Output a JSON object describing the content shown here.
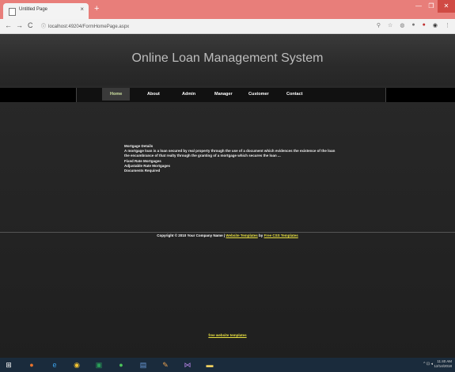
{
  "browser": {
    "tab_title": "Untitled Page",
    "tab_close": "×",
    "new_tab": "+",
    "url_prefix": "ⓘ",
    "url": "localhost:49204/FormHomePage.aspx",
    "back": "←",
    "forward": "→",
    "reload": "C",
    "window_buttons": {
      "minimize": "—",
      "maximize": "❐",
      "close": "✕"
    },
    "toolbar_icons": [
      "search-icon",
      "star-icon",
      "extension-icon",
      "extension-icon",
      "opera-icon",
      "account-icon",
      "menu-icon"
    ]
  },
  "site": {
    "title": "Online Loan Management System",
    "menu": [
      {
        "label": "Home",
        "active": true
      },
      {
        "label": "About",
        "active": false
      },
      {
        "label": "Admin",
        "active": false
      },
      {
        "label": "Manager",
        "active": false
      },
      {
        "label": "Customer",
        "active": false
      },
      {
        "label": "Contact",
        "active": false
      }
    ],
    "content": {
      "heading": "Mortgage Details",
      "line1": "A mortgage loan is a loan secured by real property through the use of a document which evidences the existence of the loan",
      "line2": "the encumbrance of that realty through the granting of a mortgage which secures the loan ...",
      "items": [
        "Fixed Rate Mortgages",
        "Adjustable Rate Mortgages",
        "Documents Required"
      ]
    },
    "footer": {
      "prefix": "Copyright © 2010 Your Company Name |",
      "link1": "Website Templates",
      "mid": "by",
      "link2": "Free CSS Templates"
    },
    "bottom_link": "free website templates"
  },
  "taskbar": {
    "icons": [
      "windows-icon",
      "firefox-icon",
      "ie-icon",
      "chrome-icon",
      "store-icon",
      "whatsapp-icon",
      "notes-icon",
      "paint-icon",
      "visual-studio-icon",
      "explorer-icon"
    ],
    "time": "11:40 AM",
    "date": "12/14/2018"
  },
  "colors": {
    "titlebar": "#e87e7a",
    "page_bg": "#222222",
    "link": "#e8e040",
    "taskbar": "#1a2b3c"
  }
}
